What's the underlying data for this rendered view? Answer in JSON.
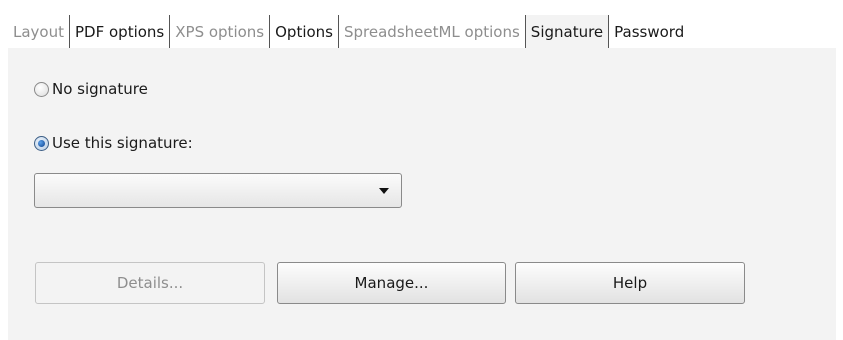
{
  "tabs": [
    {
      "label": "Layout",
      "state": "disabled"
    },
    {
      "label": "PDF options",
      "state": "enabled"
    },
    {
      "label": "XPS options",
      "state": "disabled"
    },
    {
      "label": "Options",
      "state": "enabled"
    },
    {
      "label": "SpreadsheetML options",
      "state": "disabled"
    },
    {
      "label": "Signature",
      "state": "active"
    },
    {
      "label": "Password",
      "state": "enabled"
    }
  ],
  "signature": {
    "no_signature_label": "No signature",
    "no_signature_checked": false,
    "use_signature_label": "Use this signature:",
    "use_signature_checked": true,
    "dropdown_value": ""
  },
  "buttons": {
    "details_label": "Details...",
    "details_enabled": false,
    "manage_label": "Manage...",
    "help_label": "Help"
  },
  "colors": {
    "panel_background": "#f3f3f3",
    "disabled_text": "#8e8e8e",
    "radio_selected": "#0b3f8c"
  }
}
